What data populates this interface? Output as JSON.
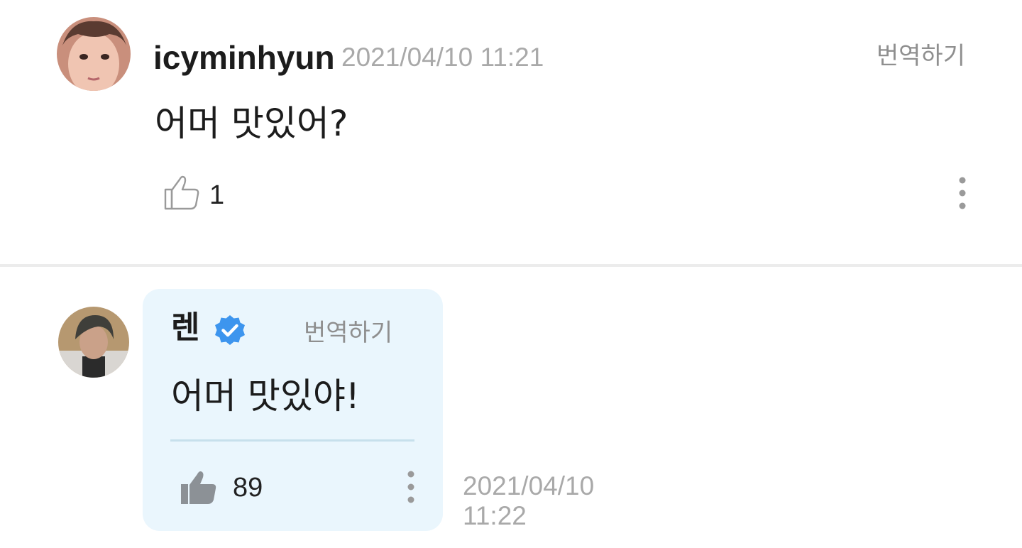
{
  "comment": {
    "avatar_icon": "user-avatar-photo",
    "username": "icyminhyun",
    "timestamp": "2021/04/10 11:21",
    "translate_label": "번역하기",
    "message": "어머 맛있어?",
    "like_icon": "thumbs-up-outline-icon",
    "like_count": "1",
    "more_icon": "vertical-ellipsis-icon"
  },
  "reply": {
    "avatar_icon": "artist-avatar-photo",
    "username": "렌",
    "verified_icon": "verified-badge-icon",
    "translate_label": "번역하기",
    "message": "어머 맛있야!",
    "like_icon": "thumbs-up-filled-icon",
    "like_count": "89",
    "more_icon": "vertical-ellipsis-icon",
    "timestamp_date": "2021/04/10",
    "timestamp_time": "11:22"
  },
  "colors": {
    "background": "#ffffff",
    "reply_bubble": "#eaf6fd",
    "verified_badge": "#3d95ee",
    "muted_text": "#a9a9a9",
    "primary_text": "#1c1c1c",
    "divider": "#ececec"
  }
}
